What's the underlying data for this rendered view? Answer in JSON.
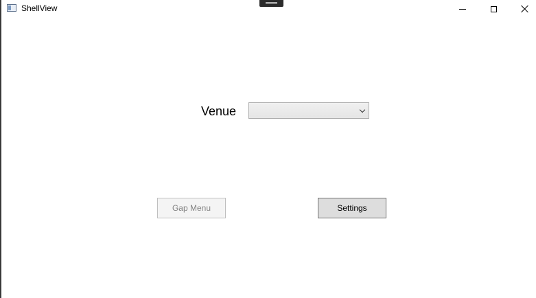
{
  "window": {
    "title": "ShellView",
    "controls": {
      "minimize": "minimize-icon",
      "maximize": "maximize-icon",
      "close": "close-icon"
    }
  },
  "main": {
    "venue_label": "Venue",
    "venue_select": {
      "selected": ""
    },
    "buttons": {
      "gap_menu": "Gap Menu",
      "gap_menu_enabled": false,
      "settings": "Settings"
    }
  }
}
